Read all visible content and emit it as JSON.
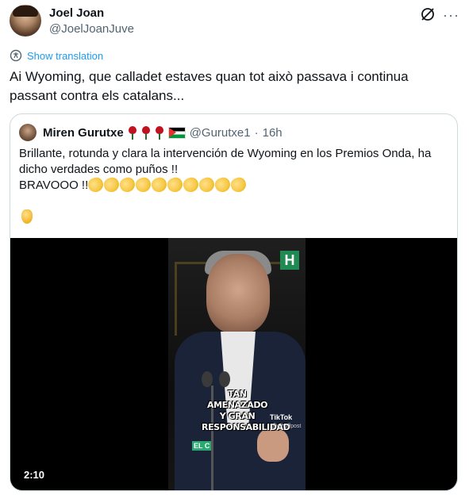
{
  "tweet": {
    "author_name": "Joel Joan",
    "author_handle": "@JoelJoanJuve",
    "translate_label": "Show translation",
    "text": "Ai Wyoming, que calladet estaves quan tot això passava i continua passant contra els catalans...",
    "grok_icon": "grok-icon",
    "more_icon": "···"
  },
  "quote": {
    "author_name": "Miren Gurutxe",
    "author_handle": "@Gurutxe1",
    "separator": "·",
    "time": "16h",
    "text_line1": "Brillante, rotunda y clara la intervención de Wyoming en los Premios Onda, ha",
    "text_line2": "dicho verdades como puños !!",
    "text_line3": "BRAVOOO !!",
    "clap_count": 10,
    "video": {
      "caption_line1": "TAN AMENAZADO",
      "caption_line2": "Y GRAN",
      "caption_line3": "RESPONSABILIDAD",
      "watermark": "TikTok",
      "watermark_user": "@elhuffpost",
      "channel_logo": "H",
      "lower_label": "EL C",
      "duration": "2:10"
    }
  },
  "colors": {
    "link": "#1d9bf0",
    "secondary_text": "#536471",
    "border": "#cfd9de"
  }
}
